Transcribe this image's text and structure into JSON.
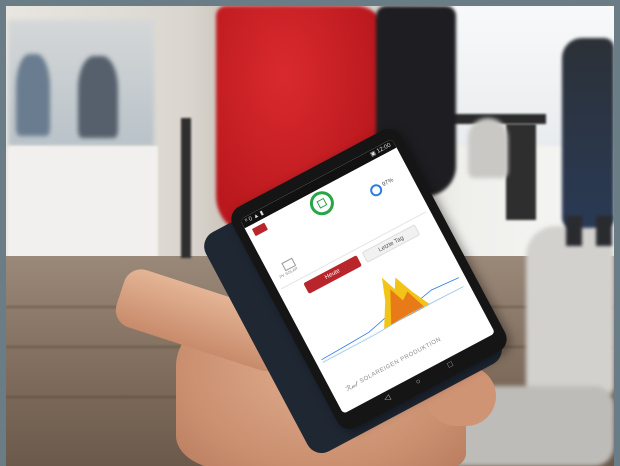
{
  "phone": {
    "status_left": "ᵗˡ 0 ▲ ▮",
    "status_right": "▣ 12:00",
    "battery_percent": "97%",
    "solar_label": "PV SOLAR",
    "tab_active": "Heute",
    "tab_inactive": "Letzte Tag",
    "footer_logo": "ℛ𝒶𝓁",
    "footer_text": "SOLAREIGEN PRODUKTION",
    "nav_back": "◁",
    "nav_home": "○",
    "nav_recent": "□"
  },
  "colors": {
    "brand_red": "#b8262b",
    "status_green": "#27a646",
    "chart_yellow": "#f2c418",
    "chart_orange": "#e87b18",
    "chart_blue": "#2c7be5"
  },
  "icons": {
    "brand": "brand-logo-icon",
    "status": "house-icon",
    "battery": "battery-icon",
    "solar": "solar-panel-icon"
  }
}
